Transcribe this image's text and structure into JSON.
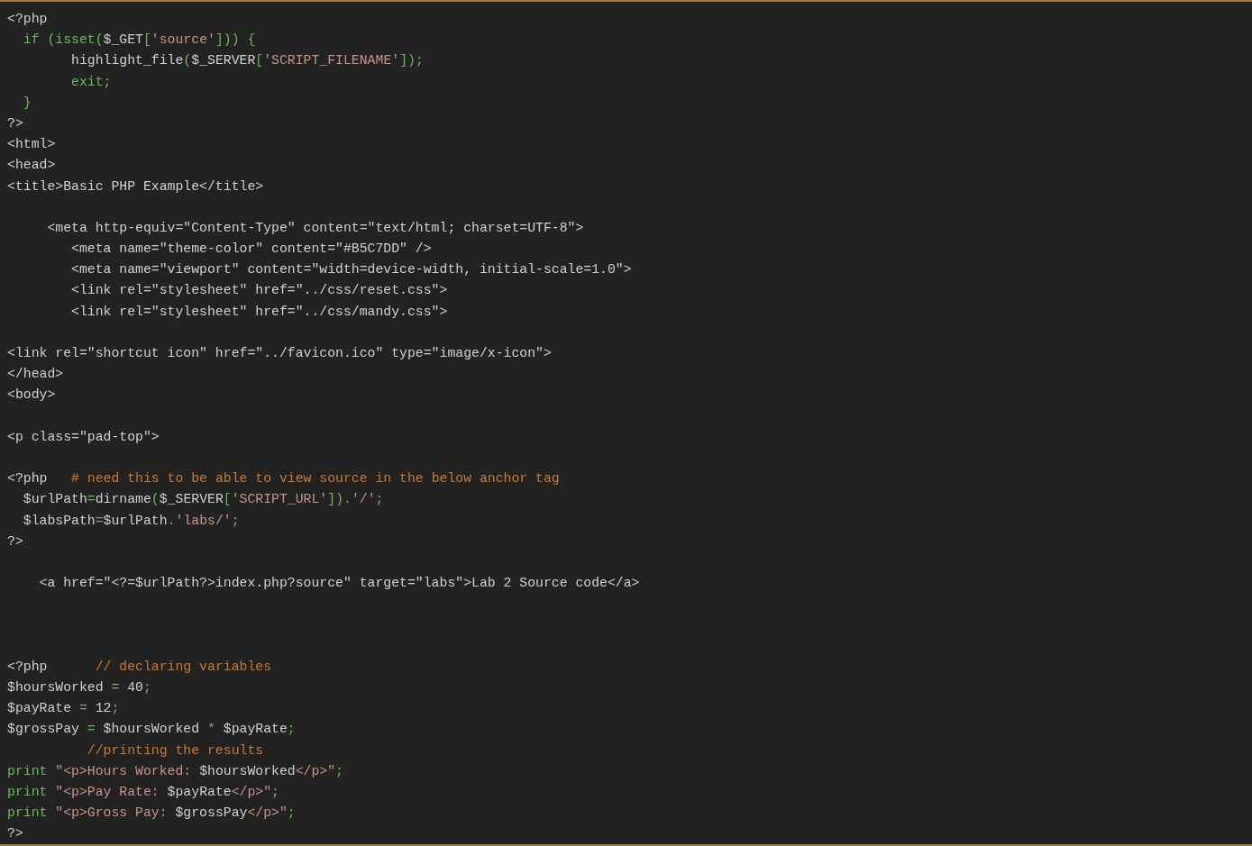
{
  "code_lines": [
    {
      "kind": "code",
      "segments": [
        {
          "kind": "plain",
          "text": "<?php"
        }
      ]
    },
    {
      "kind": "code",
      "segments": [
        {
          "kind": "keyword",
          "text": "  if (isset("
        },
        {
          "kind": "plain",
          "text": "$_GET"
        },
        {
          "kind": "keyword",
          "text": "["
        },
        {
          "kind": "string",
          "text": "'source'"
        },
        {
          "kind": "keyword",
          "text": "])) {"
        }
      ]
    },
    {
      "kind": "code",
      "segments": [
        {
          "kind": "plain",
          "text": "        highlight_file"
        },
        {
          "kind": "keyword",
          "text": "("
        },
        {
          "kind": "plain",
          "text": "$_SERVER"
        },
        {
          "kind": "keyword",
          "text": "["
        },
        {
          "kind": "string",
          "text": "'SCRIPT_FILENAME'"
        },
        {
          "kind": "keyword",
          "text": "]);"
        }
      ]
    },
    {
      "kind": "code",
      "segments": [
        {
          "kind": "keyword",
          "text": "        exit;"
        }
      ]
    },
    {
      "kind": "code",
      "segments": [
        {
          "kind": "keyword",
          "text": "  }"
        }
      ]
    },
    {
      "kind": "code",
      "segments": [
        {
          "kind": "plain",
          "text": "?>"
        }
      ]
    },
    {
      "kind": "code",
      "segments": [
        {
          "kind": "plain",
          "text": "<html>"
        }
      ]
    },
    {
      "kind": "code",
      "segments": [
        {
          "kind": "plain",
          "text": "<head>"
        }
      ]
    },
    {
      "kind": "code",
      "segments": [
        {
          "kind": "plain",
          "text": "<title>Basic PHP Example</title>"
        }
      ]
    },
    {
      "kind": "blank"
    },
    {
      "kind": "code",
      "segments": [
        {
          "kind": "plain",
          "text": "     <meta http-equiv=\"Content-Type\" content=\"text/html; charset=UTF-8\">"
        }
      ]
    },
    {
      "kind": "code",
      "segments": [
        {
          "kind": "plain",
          "text": "        <meta name=\"theme-color\" content=\"#B5C7DD\" />"
        }
      ]
    },
    {
      "kind": "code",
      "segments": [
        {
          "kind": "plain",
          "text": "        <meta name=\"viewport\" content=\"width=device-width, initial-scale=1.0\">"
        }
      ]
    },
    {
      "kind": "code",
      "segments": [
        {
          "kind": "plain",
          "text": "        <link rel=\"stylesheet\" href=\"../css/reset.css\">"
        }
      ]
    },
    {
      "kind": "code",
      "segments": [
        {
          "kind": "plain",
          "text": "        <link rel=\"stylesheet\" href=\"../css/mandy.css\">"
        }
      ]
    },
    {
      "kind": "blank"
    },
    {
      "kind": "code",
      "segments": [
        {
          "kind": "plain",
          "text": "<link rel=\"shortcut icon\" href=\"../favicon.ico\" type=\"image/x-icon\">"
        }
      ]
    },
    {
      "kind": "code",
      "segments": [
        {
          "kind": "plain",
          "text": "</head>"
        }
      ]
    },
    {
      "kind": "code",
      "segments": [
        {
          "kind": "plain",
          "text": "<body>"
        }
      ]
    },
    {
      "kind": "blank"
    },
    {
      "kind": "code",
      "segments": [
        {
          "kind": "plain",
          "text": "<p class=\"pad-top\">"
        }
      ]
    },
    {
      "kind": "blank"
    },
    {
      "kind": "code",
      "segments": [
        {
          "kind": "plain",
          "text": "<?php"
        },
        {
          "kind": "comment",
          "text": "   # need this to be able to view source in the below anchor tag"
        }
      ]
    },
    {
      "kind": "code",
      "segments": [
        {
          "kind": "plain",
          "text": "  $urlPath"
        },
        {
          "kind": "keyword",
          "text": "="
        },
        {
          "kind": "plain",
          "text": "dirname"
        },
        {
          "kind": "keyword",
          "text": "("
        },
        {
          "kind": "plain",
          "text": "$_SERVER"
        },
        {
          "kind": "keyword",
          "text": "["
        },
        {
          "kind": "string",
          "text": "'SCRIPT_URL'"
        },
        {
          "kind": "keyword",
          "text": "])."
        },
        {
          "kind": "string",
          "text": "'/'"
        },
        {
          "kind": "keyword",
          "text": ";"
        }
      ]
    },
    {
      "kind": "code",
      "segments": [
        {
          "kind": "plain",
          "text": "  $labsPath"
        },
        {
          "kind": "keyword",
          "text": "="
        },
        {
          "kind": "plain",
          "text": "$urlPath"
        },
        {
          "kind": "keyword",
          "text": "."
        },
        {
          "kind": "string",
          "text": "'labs/'"
        },
        {
          "kind": "keyword",
          "text": ";"
        }
      ]
    },
    {
      "kind": "code",
      "segments": [
        {
          "kind": "plain",
          "text": "?>"
        }
      ]
    },
    {
      "kind": "blank"
    },
    {
      "kind": "code",
      "segments": [
        {
          "kind": "plain",
          "text": "    <a href=\"<?=$urlPath?>index.php?source\" target=\"labs\">Lab 2 Source code</a>"
        }
      ]
    },
    {
      "kind": "blank"
    },
    {
      "kind": "blank"
    },
    {
      "kind": "blank"
    },
    {
      "kind": "code",
      "segments": [
        {
          "kind": "plain",
          "text": "<?php"
        },
        {
          "kind": "comment",
          "text": "      // declaring variables"
        }
      ]
    },
    {
      "kind": "code",
      "segments": [
        {
          "kind": "plain",
          "text": "$hoursWorked "
        },
        {
          "kind": "keyword",
          "text": "="
        },
        {
          "kind": "plain",
          "text": " 40"
        },
        {
          "kind": "keyword",
          "text": ";"
        }
      ]
    },
    {
      "kind": "code",
      "segments": [
        {
          "kind": "plain",
          "text": "$payRate "
        },
        {
          "kind": "keyword",
          "text": "="
        },
        {
          "kind": "plain",
          "text": " 12"
        },
        {
          "kind": "keyword",
          "text": ";"
        }
      ]
    },
    {
      "kind": "code",
      "segments": [
        {
          "kind": "plain",
          "text": "$grossPay "
        },
        {
          "kind": "keyword",
          "text": "="
        },
        {
          "kind": "plain",
          "text": " $hoursWorked "
        },
        {
          "kind": "keyword",
          "text": "*"
        },
        {
          "kind": "plain",
          "text": " $payRate"
        },
        {
          "kind": "keyword",
          "text": ";"
        }
      ]
    },
    {
      "kind": "code",
      "segments": [
        {
          "kind": "comment",
          "text": "          //printing the results"
        }
      ]
    },
    {
      "kind": "code",
      "segments": [
        {
          "kind": "keyword",
          "text": "print "
        },
        {
          "kind": "string",
          "text": "\"<p>Hours Worked: "
        },
        {
          "kind": "plain",
          "text": "$hoursWorked"
        },
        {
          "kind": "string",
          "text": "</p>\""
        },
        {
          "kind": "keyword",
          "text": ";"
        }
      ]
    },
    {
      "kind": "code",
      "segments": [
        {
          "kind": "keyword",
          "text": "print "
        },
        {
          "kind": "string",
          "text": "\"<p>Pay Rate: "
        },
        {
          "kind": "plain",
          "text": "$payRate"
        },
        {
          "kind": "string",
          "text": "</p>\""
        },
        {
          "kind": "keyword",
          "text": ";"
        }
      ]
    },
    {
      "kind": "code",
      "segments": [
        {
          "kind": "keyword",
          "text": "print "
        },
        {
          "kind": "string",
          "text": "\"<p>Gross Pay: "
        },
        {
          "kind": "plain",
          "text": "$grossPay"
        },
        {
          "kind": "string",
          "text": "</p>\""
        },
        {
          "kind": "keyword",
          "text": ";"
        }
      ]
    },
    {
      "kind": "code",
      "segments": [
        {
          "kind": "plain",
          "text": "?>"
        }
      ]
    }
  ]
}
